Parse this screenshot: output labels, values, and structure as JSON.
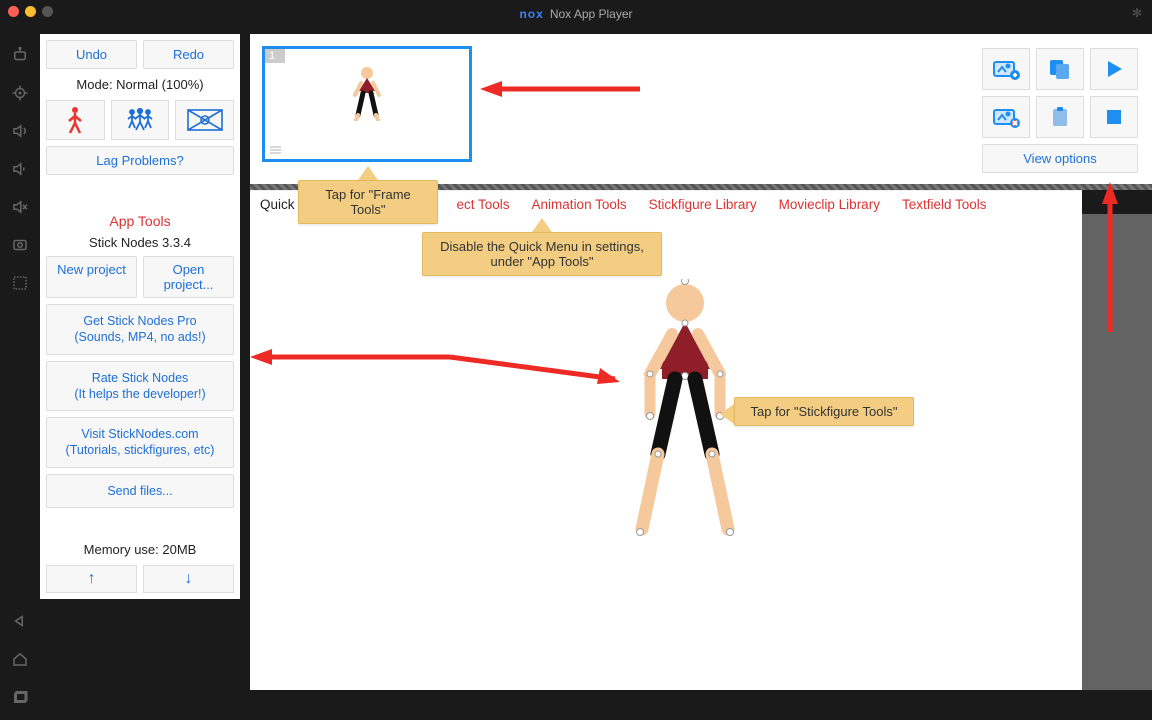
{
  "window": {
    "title": "Nox App Player",
    "brand": "nox"
  },
  "left": {
    "undo": "Undo",
    "redo": "Redo",
    "mode": "Mode: Normal (100%)",
    "lag": "Lag Problems?",
    "apptools_hdr": "App Tools",
    "version": "Stick Nodes 3.3.4",
    "newproj": "New project",
    "openproj": "Open project...",
    "getpro": "Get Stick Nodes Pro\n(Sounds, MP4, no ads!)",
    "rate": "Rate Stick Nodes\n(It helps the developer!)",
    "visit": "Visit StickNodes.com\n(Tutorials, stickfigures, etc)",
    "send": "Send files...",
    "memory": "Memory use: 20MB"
  },
  "tabs": {
    "quick": "Quick",
    "project": "ect Tools",
    "animation": "Animation Tools",
    "library": "Stickfigure Library",
    "movieclip": "Movieclip Library",
    "textfield": "Textfield Tools"
  },
  "tips": {
    "frame": "Tap for \"Frame Tools\"",
    "quickmenu": "Disable the Quick Menu in settings, under \"App Tools\"",
    "stick": "Tap for \"Stickfigure Tools\""
  },
  "right": {
    "viewoptions": "View options"
  },
  "frame": {
    "number": "1"
  },
  "colors": {
    "skin": "#f5c99b",
    "shirt": "#8f1e28",
    "pants": "#111111",
    "accent_blue": "#1e8ff0",
    "link_blue": "#1e6fd6",
    "tip_bg": "#f3ce82",
    "red": "#ee2a24"
  }
}
